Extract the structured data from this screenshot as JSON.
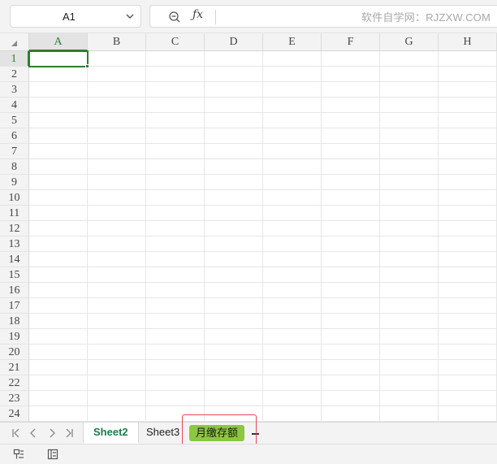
{
  "formula_bar": {
    "namebox_value": "A1",
    "watermark": "软件自学网：RJZXW.COM"
  },
  "columns": [
    "A",
    "B",
    "C",
    "D",
    "E",
    "F",
    "G",
    "H"
  ],
  "rows": [
    "1",
    "2",
    "3",
    "4",
    "5",
    "6",
    "7",
    "8",
    "9",
    "10",
    "11",
    "12",
    "13",
    "14",
    "15",
    "16",
    "17",
    "18",
    "19",
    "20",
    "21",
    "22",
    "23",
    "24"
  ],
  "active_cell": {
    "column": "A",
    "row": "1"
  },
  "sheet_tabs": {
    "sheet2": "Sheet2",
    "sheet3": "Sheet3",
    "month": "月缴存额"
  },
  "colors": {
    "accent_green": "#2f7d32",
    "tab_green": "#8dc63f",
    "highlight_red": "#e0475b"
  }
}
